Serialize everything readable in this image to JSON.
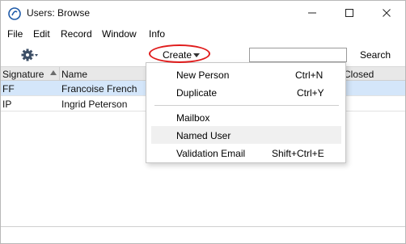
{
  "window": {
    "title": "Users: Browse"
  },
  "menubar": {
    "items": [
      "File",
      "Edit",
      "Record",
      "Window",
      "Info"
    ]
  },
  "toolbar": {
    "create_label": "Create",
    "search_value": "",
    "search_label": "Search"
  },
  "table": {
    "headers": [
      "Signature",
      "Name",
      "Closed"
    ],
    "rows": [
      {
        "signature": "FF",
        "name": "Francoise French"
      },
      {
        "signature": "IP",
        "name": "Ingrid Peterson"
      }
    ]
  },
  "create_menu": {
    "items": [
      {
        "label": "New Person",
        "shortcut": "Ctrl+N"
      },
      {
        "label": "Duplicate",
        "shortcut": "Ctrl+Y"
      },
      {
        "label": "Mailbox",
        "shortcut": ""
      },
      {
        "label": "Named User",
        "shortcut": ""
      },
      {
        "label": "Validation Email",
        "shortcut": "Shift+Ctrl+E"
      }
    ]
  },
  "colors": {
    "highlight_ring": "#e01b1b",
    "selected_row": "#d4e6fa"
  }
}
